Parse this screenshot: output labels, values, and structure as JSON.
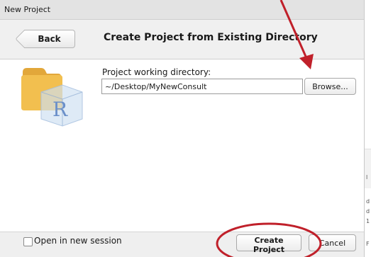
{
  "window": {
    "title": "New Project"
  },
  "header": {
    "back_label": "Back",
    "title": "Create Project from Existing Directory"
  },
  "form": {
    "wd_label": "Project working directory:",
    "wd_value": "~/Desktop/MyNewConsult",
    "browse_label": "Browse..."
  },
  "footer": {
    "open_new_session_label": "Open in new session",
    "open_new_session_checked": false,
    "create_label": "Create Project",
    "cancel_label": "Cancel"
  },
  "icons": {
    "folder": "r-project-folder-icon"
  },
  "colors": {
    "annotation": "#c0202a",
    "folder": "#f2bf4f",
    "r_logo": "#6a8fc9"
  },
  "background": {
    "fragments": [
      "l",
      "d",
      "d",
      "1",
      "F"
    ]
  }
}
